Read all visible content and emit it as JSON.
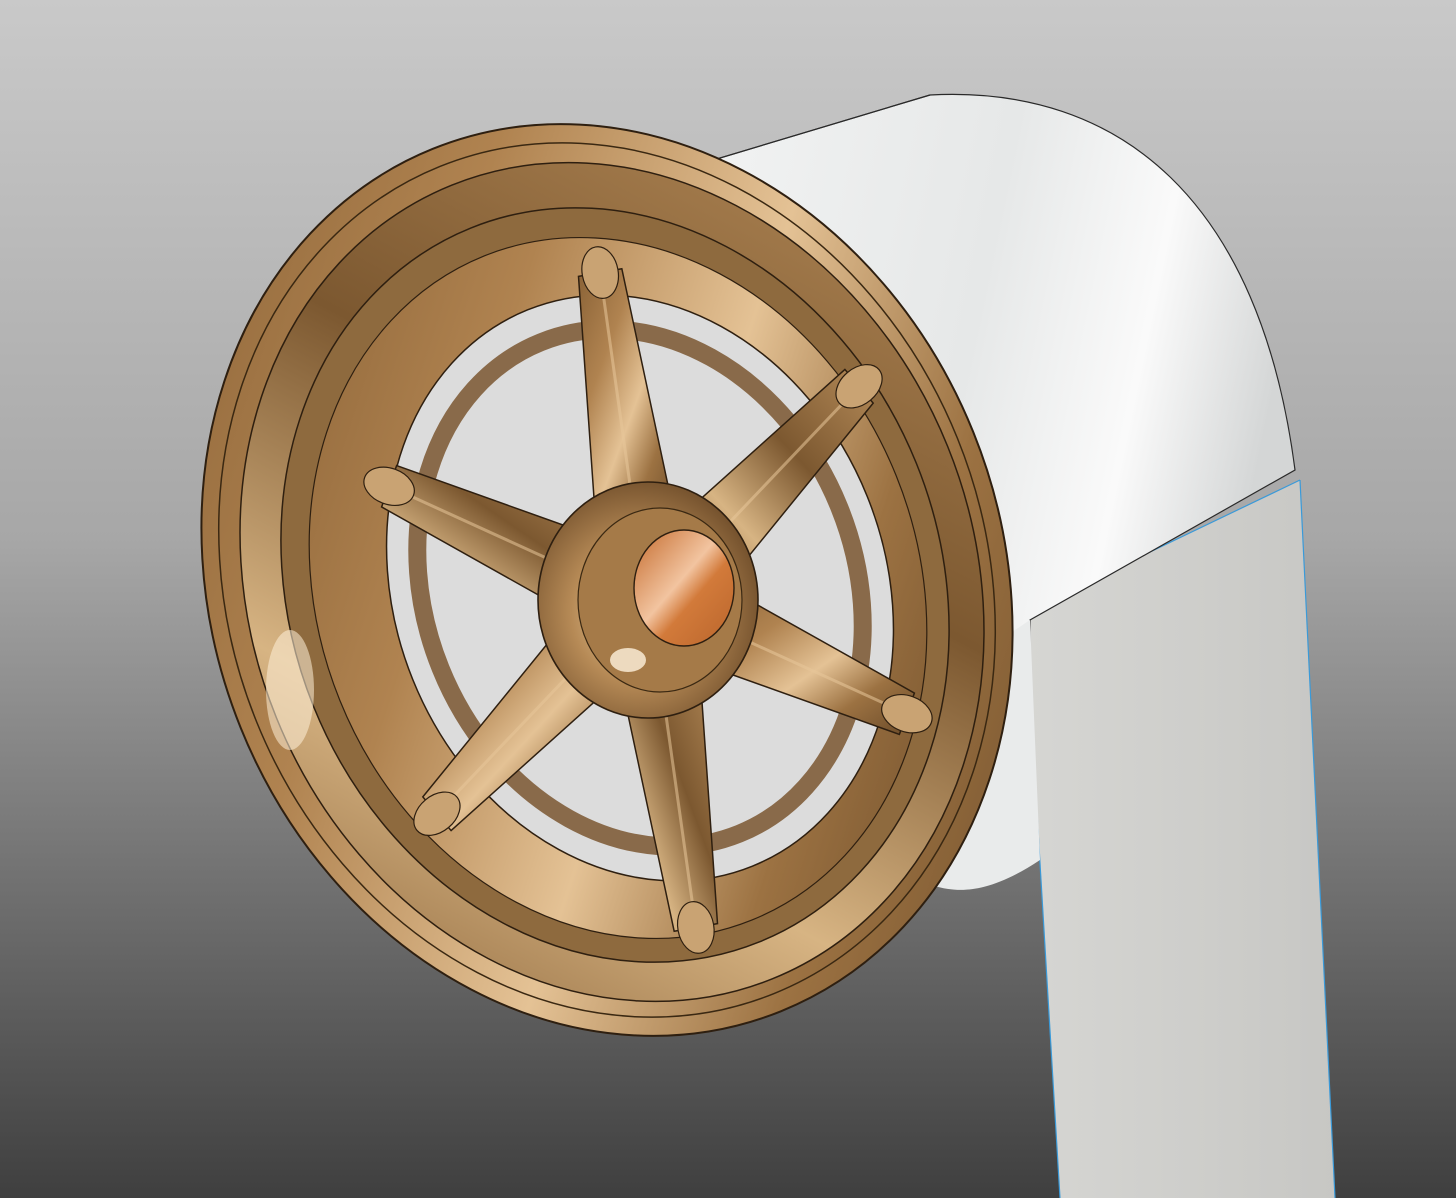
{
  "viewport": {
    "background_top": "#c9c9c9",
    "background_mid": "#a7a7a7",
    "background_bottom": "#3f3f3f"
  },
  "model": {
    "part": "wheel",
    "spoke_count": 6,
    "material_color": "#a67c4c",
    "material_shadow": "#6b4a28",
    "material_highlight": "#e8c79a",
    "hub_bore_color": "#d07a3a",
    "tire_color": "#e3e5e5",
    "strap_color": "#cacac8",
    "edge_highlight_color": "#3a9ad9"
  }
}
